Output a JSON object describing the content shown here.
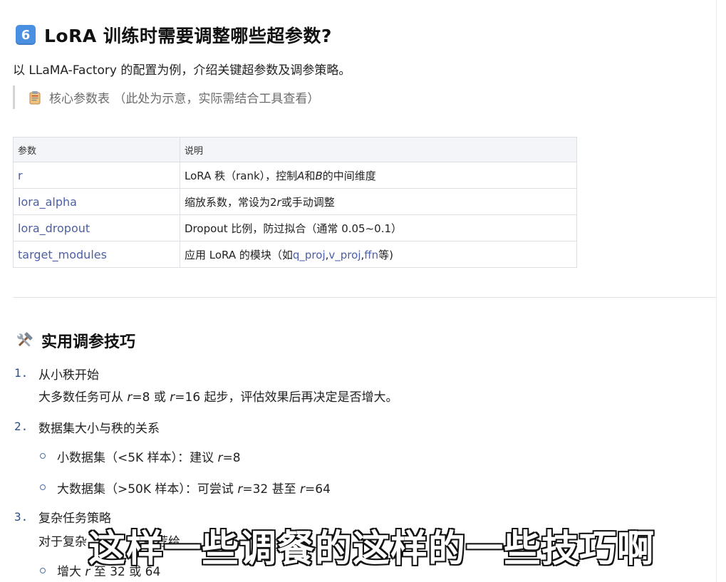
{
  "heading": {
    "badge": "6",
    "title": "LoRA 训练时需要调整哪些超参数?"
  },
  "intro": "以 LLaMA-Factory 的配置为例，介绍关键超参数及调参策略。",
  "quote": "核心参数表 （此处为示意，实际需结合工具查看）",
  "table": {
    "headers": [
      "参数",
      "说明"
    ],
    "rows": [
      {
        "param": "r",
        "desc": [
          "LoRA 秩（rank），控制",
          "A",
          "和",
          "B",
          "的中间维度"
        ]
      },
      {
        "param": "lora_alpha",
        "desc": [
          "缩放系数，常设为2",
          "r",
          "或手动调整"
        ]
      },
      {
        "param": "lora_dropout",
        "desc": [
          "Dropout 比例，防过拟合（通常 0.05~0.1）"
        ]
      },
      {
        "param": "target_modules",
        "desc": [
          "应用 LoRA 的模块（如",
          "q_proj",
          ",",
          "v_proj",
          ",",
          "ffn",
          "等)"
        ]
      }
    ]
  },
  "section": {
    "title": "实用调参技巧"
  },
  "tips": [
    {
      "num": "1.",
      "title": "从小秩开始",
      "desc": [
        "大多数任务可从 ",
        "r",
        "=8 或 ",
        "r",
        "=16 起步，评估效果后再决定是否增大。"
      ]
    },
    {
      "num": "2.",
      "title": "数据集大小与秩的关系",
      "subs": [
        [
          "小数据集（<5K 样本）：建议 ",
          "r",
          "=8"
        ],
        [
          "大数据集（>50K 样本）：可尝试 ",
          "r",
          "=32 甚至 ",
          "r",
          "=64"
        ]
      ]
    },
    {
      "num": "3.",
      "title": "复杂任务策略",
      "desc": [
        "对于复杂",
        "推荐给"
      ],
      "subs": [
        [
          "增大 ",
          "r",
          " 至 32 或 64"
        ]
      ]
    }
  ],
  "caption": "这样一些调餐的这样的一些技巧啊"
}
